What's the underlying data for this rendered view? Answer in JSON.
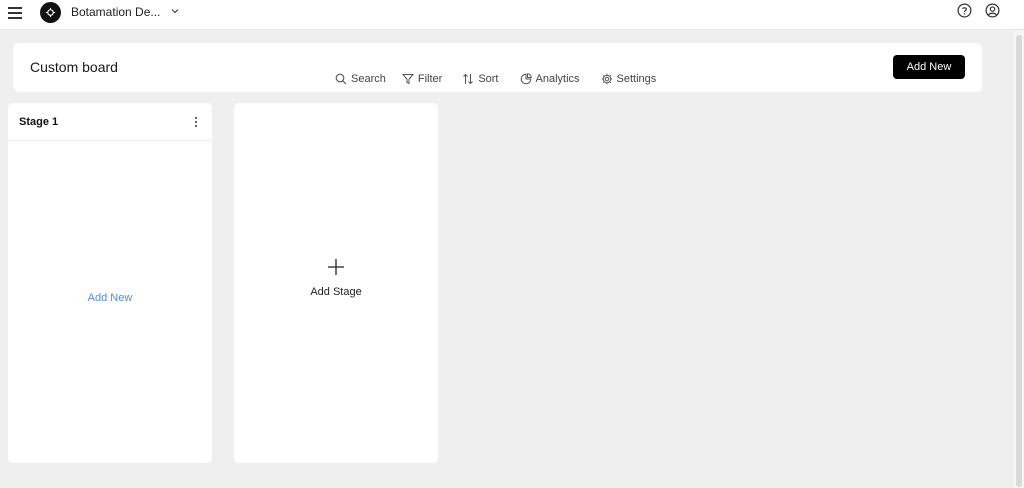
{
  "topbar": {
    "workspace_name": "Botamation De...",
    "icons": [
      "menu-icon",
      "workspace-logo",
      "chevron-down-icon",
      "help-icon",
      "user-icon"
    ]
  },
  "board": {
    "title": "Custom board",
    "toolbar": {
      "search_label": "Search",
      "filter_label": "Filter",
      "sort_label": "Sort",
      "analytics_label": "Analytics",
      "settings_label": "Settings"
    },
    "add_new_label": "Add New"
  },
  "stages": [
    {
      "title": "Stage 1",
      "add_new_label": "Add New"
    }
  ],
  "add_stage": {
    "label": "Add Stage"
  },
  "colors": {
    "background": "#efefef",
    "card": "#ffffff",
    "primary_button": "#000000",
    "link": "#4a90d9"
  }
}
